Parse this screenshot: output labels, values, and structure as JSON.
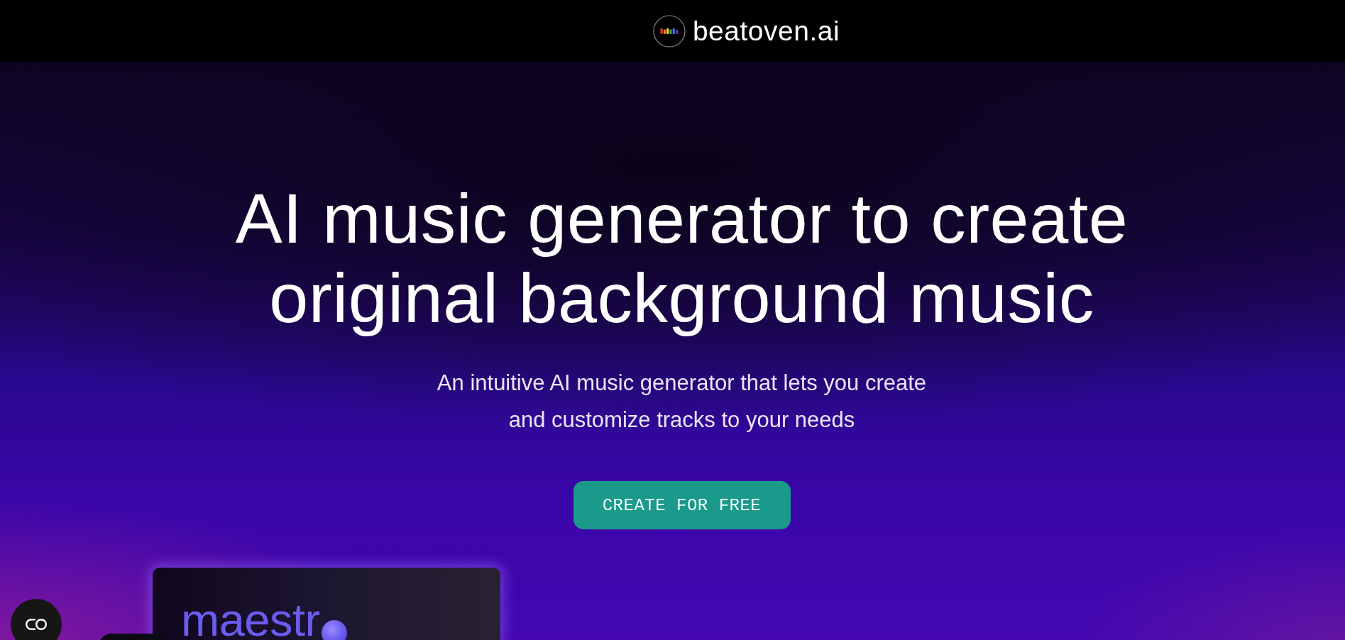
{
  "header": {
    "logo_text": "beatoven.ai"
  },
  "hero": {
    "headline": "AI music generator to create original background music",
    "subtitle": "An intuitive AI music generator that lets you create and customize tracks to your needs",
    "cta_button": {
      "label": "CREATE FOR FREE"
    }
  },
  "preview_card": {
    "title": "maestr"
  }
}
